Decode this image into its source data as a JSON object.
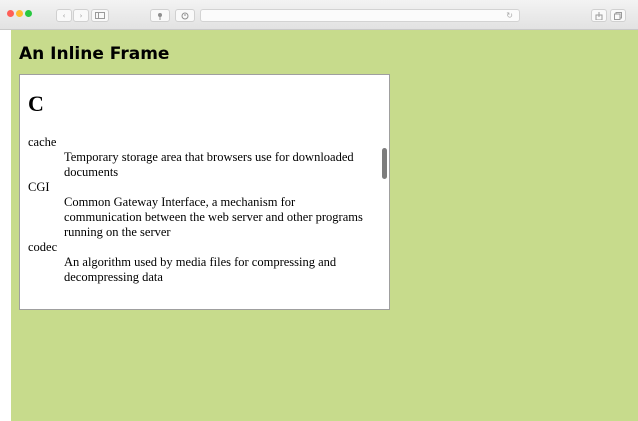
{
  "browser": {
    "back_glyph": "‹",
    "forward_glyph": "›",
    "reload_glyph": "↻"
  },
  "page": {
    "title": "An Inline Frame",
    "background": "#c7db8c"
  },
  "iframe": {
    "letter": "C",
    "entries": [
      {
        "term": "cache",
        "definition": "Temporary storage area that browsers use for downloaded documents"
      },
      {
        "term": "CGI",
        "definition": "Common Gateway Interface, a mechanism for communication between the web server and other programs running on the server"
      },
      {
        "term": "codec",
        "definition": "An algorithm used by media files for compressing and decompressing data"
      }
    ]
  }
}
